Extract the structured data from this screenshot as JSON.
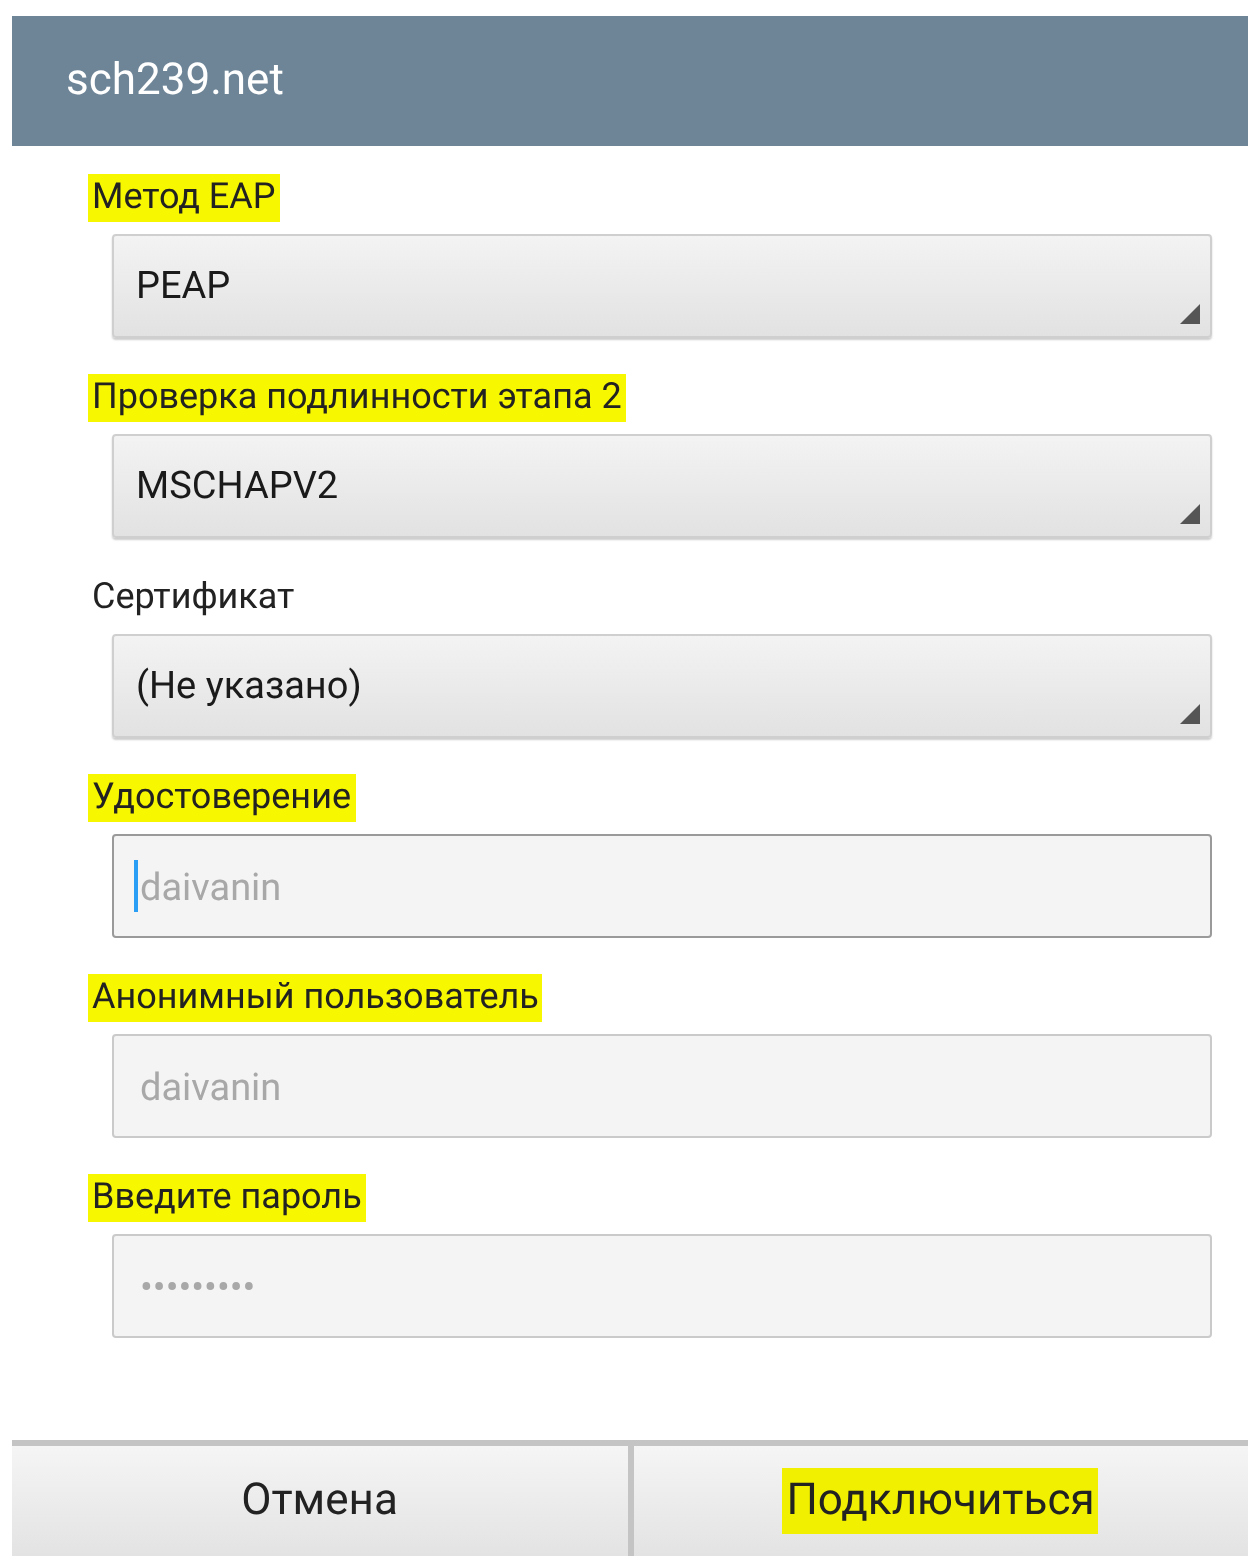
{
  "window": {
    "title": "sch239.net"
  },
  "fields": [
    {
      "kind": "select",
      "label": "Метод EAP",
      "highlighted": true,
      "value": "PEAP"
    },
    {
      "kind": "select",
      "label": "Проверка подлинности этапа 2",
      "highlighted": true,
      "value": "MSCHAPV2"
    },
    {
      "kind": "select",
      "label": "Сертификат",
      "highlighted": false,
      "value": "(Не указано)"
    },
    {
      "kind": "input",
      "label": "Удостоверение",
      "highlighted": true,
      "placeholder": "daivanin",
      "focused": true
    },
    {
      "kind": "input",
      "label": "Анонимный пользователь",
      "highlighted": true,
      "placeholder": "daivanin",
      "focused": false
    },
    {
      "kind": "input",
      "label": "Введите пароль",
      "highlighted": true,
      "placeholder": "•••••••••",
      "focused": false
    }
  ],
  "buttons": [
    {
      "label": "Отмена",
      "highlighted": false
    },
    {
      "label": "Подключиться",
      "highlighted": true
    }
  ]
}
